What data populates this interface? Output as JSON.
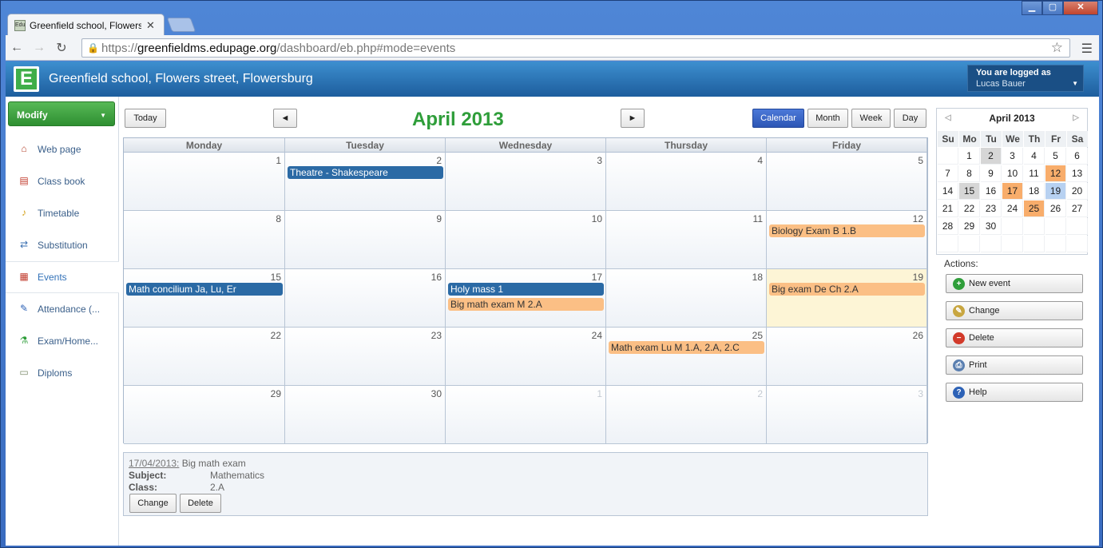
{
  "browser": {
    "tab_title": "Greenfield school, Flowers st",
    "tab_favicon": "Edu",
    "url_scheme": "https://",
    "url_host": "greenfieldms.edupage.org",
    "url_path": "/dashboard/eb.php#mode=events"
  },
  "header": {
    "logo_letter": "E",
    "school_name": "Greenfield school, Flowers street, Flowersburg",
    "logged_label": "You are logged as",
    "user_name": "Lucas Bauer"
  },
  "sidebar": {
    "modify_label": "Modify",
    "items": [
      {
        "label": "Web page",
        "icon": "house-icon"
      },
      {
        "label": "Class book",
        "icon": "book-icon"
      },
      {
        "label": "Timetable",
        "icon": "bell-icon"
      },
      {
        "label": "Substitution",
        "icon": "swap-icon"
      },
      {
        "label": "Events",
        "icon": "calendar-icon"
      },
      {
        "label": "Attendance (...",
        "icon": "pencil-icon"
      },
      {
        "label": "Exam/Home...",
        "icon": "flask-icon"
      },
      {
        "label": "Diploms",
        "icon": "certificate-icon"
      }
    ]
  },
  "calendar": {
    "today_label": "Today",
    "prev_label": "◄",
    "next_label": "►",
    "title": "April 2013",
    "views": [
      "Calendar",
      "Month",
      "Week",
      "Day"
    ],
    "active_view": "Calendar",
    "weekdays": [
      "Monday",
      "Tuesday",
      "Wednesday",
      "Thursday",
      "Friday"
    ],
    "weeks": [
      [
        "1",
        "2",
        "3",
        "4",
        "5"
      ],
      [
        "8",
        "9",
        "10",
        "11",
        "12"
      ],
      [
        "15",
        "16",
        "17",
        "18",
        "19"
      ],
      [
        "22",
        "23",
        "24",
        "25",
        "26"
      ],
      [
        "29",
        "30",
        "1",
        "2",
        "3"
      ]
    ],
    "today_date": "19",
    "events": [
      {
        "week": 0,
        "day": 1,
        "slot": 0,
        "title": "Theatre - Shakespeare",
        "color": "blue"
      },
      {
        "week": 1,
        "day": 4,
        "slot": 0,
        "title": "Biology Exam B 1.B",
        "color": "orange"
      },
      {
        "week": 2,
        "day": 0,
        "slot": 0,
        "title": "Math concilium Ja, Lu, Er",
        "color": "blue"
      },
      {
        "week": 2,
        "day": 2,
        "slot": 0,
        "title": "Holy mass 1",
        "color": "blue"
      },
      {
        "week": 2,
        "day": 2,
        "slot": 1,
        "title": "Big math exam M 2.A",
        "color": "orange"
      },
      {
        "week": 2,
        "day": 4,
        "slot": 0,
        "title": "Big exam De Ch 2.A",
        "color": "orange"
      },
      {
        "week": 3,
        "day": 3,
        "slot": 0,
        "title": "Math exam Lu M 1.A, 2.A, 2.C",
        "color": "orange"
      }
    ]
  },
  "detail": {
    "date": "17/04/2013:",
    "title": "Big math exam",
    "subject_label": "Subject:",
    "subject_value": "Mathematics",
    "class_label": "Class:",
    "class_value": "2.A",
    "change_label": "Change",
    "delete_label": "Delete"
  },
  "mini_calendar": {
    "title": "April 2013",
    "weekdays": [
      "Su",
      "Mo",
      "Tu",
      "We",
      "Th",
      "Fr",
      "Sa"
    ],
    "rows": [
      [
        "",
        "1",
        "2",
        "3",
        "4",
        "5",
        "6"
      ],
      [
        "7",
        "8",
        "9",
        "10",
        "11",
        "12",
        "13"
      ],
      [
        "14",
        "15",
        "16",
        "17",
        "18",
        "19",
        "20"
      ],
      [
        "21",
        "22",
        "23",
        "24",
        "25",
        "26",
        "27"
      ],
      [
        "28",
        "29",
        "30",
        "",
        "",
        "",
        ""
      ],
      [
        "",
        "",
        "",
        "",
        "",
        "",
        ""
      ]
    ],
    "highlight_gray": [
      "2",
      "15"
    ],
    "highlight_orange": [
      "12",
      "17",
      "25"
    ],
    "highlight_blue": [
      "19"
    ]
  },
  "actions": {
    "label": "Actions:",
    "buttons": [
      {
        "label": "New event",
        "icon": "plus-icon",
        "color": "#2f9e3a"
      },
      {
        "label": "Change",
        "icon": "edit-icon",
        "color": "#c8a640"
      },
      {
        "label": "Delete",
        "icon": "delete-icon",
        "color": "#d23a2a"
      },
      {
        "label": "Print",
        "icon": "printer-icon",
        "color": "#5a7fb0"
      },
      {
        "label": "Help",
        "icon": "help-icon",
        "color": "#2d62b6"
      }
    ]
  },
  "colors": {
    "accent_green": "#2f9e3a",
    "event_blue": "#2b6aa5",
    "event_orange": "#fbbf85",
    "header_blue": "#1d5d9d"
  }
}
